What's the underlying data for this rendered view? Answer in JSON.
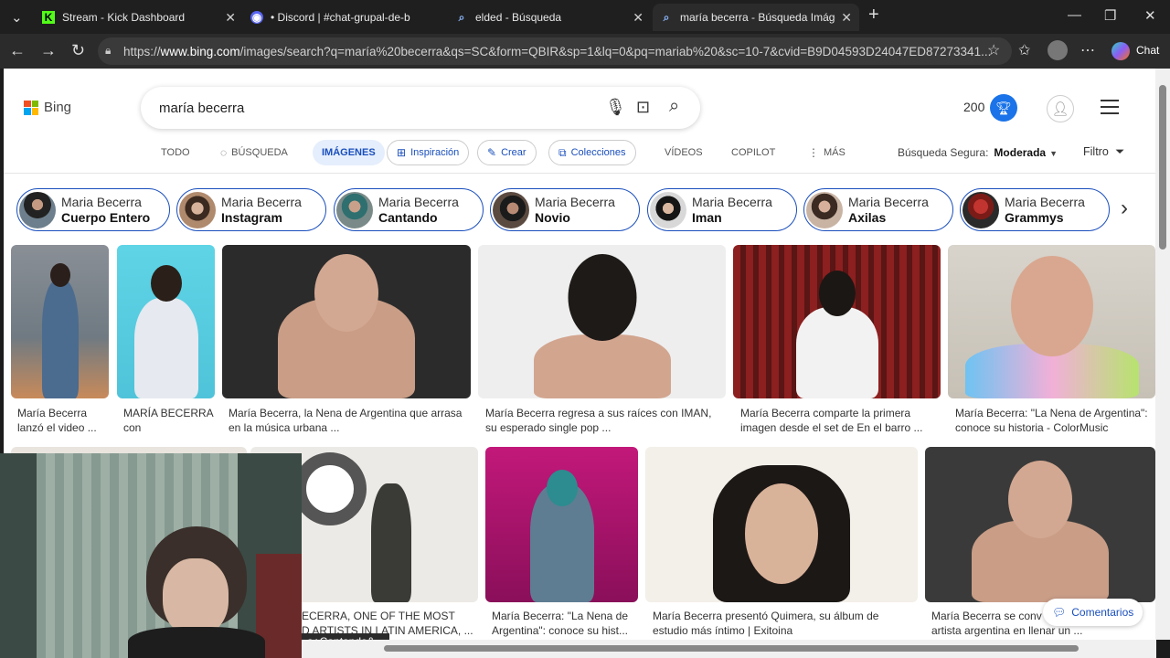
{
  "tabs": [
    {
      "label": "Stream - Kick Dashboard",
      "icon": "kick-icon"
    },
    {
      "label": "• Discord | #chat-grupal-de-b",
      "icon": "discord-icon"
    },
    {
      "label": "elded - Búsqueda",
      "icon": "search-icon"
    },
    {
      "label": "maría becerra - Búsqueda Imágen",
      "icon": "search-icon"
    }
  ],
  "browser": {
    "url_domain": "www.bing.com",
    "url_prefix": "https://",
    "url_rest": "/images/search?q=maría%20becerra&qs=SC&form=QBIR&sp=1&lq=0&pq=mariab%20&sc=10-7&cvid=B9D04593D24047ED87273341...",
    "chat_label": "Chat"
  },
  "bing": {
    "logo_text": "Bing",
    "search_value": "maría becerra",
    "rewards_points": "200"
  },
  "nav": {
    "todo": "TODO",
    "busqueda": "BÚSQUEDA",
    "imagenes": "IMÁGENES",
    "inspiracion": "Inspiración",
    "crear": "Crear",
    "colecciones": "Colecciones",
    "videos": "VÍDEOS",
    "copilot": "COPILOT",
    "mas": "MÁS",
    "safe_label": "Búsqueda Segura:",
    "safe_value": "Moderada",
    "filter_label": "Filtro"
  },
  "chips": [
    {
      "line1": "Maria Becerra",
      "line2": "Cuerpo Entero"
    },
    {
      "line1": "Maria Becerra",
      "line2": "Instagram"
    },
    {
      "line1": "Maria Becerra",
      "line2": "Cantando"
    },
    {
      "line1": "Maria Becerra",
      "line2": "Novio"
    },
    {
      "line1": "Maria Becerra",
      "line2": "Iman"
    },
    {
      "line1": "Maria Becerra",
      "line2": "Axilas"
    },
    {
      "line1": "Maria Becerra",
      "line2": "Grammys"
    }
  ],
  "results_row1": [
    {
      "caption": "María Becerra lanzó el video ..."
    },
    {
      "caption": "MARÍA BECERRA con"
    },
    {
      "caption": "María Becerra, la Nena de Argentina que arrasa en la música urbana ..."
    },
    {
      "caption": "María Becerra regresa a sus raíces con IMAN, su esperado single pop ..."
    },
    {
      "caption": "María Becerra comparte la primera imagen desde el set de En el barro ..."
    },
    {
      "caption": "María Becerra: \"La Nena de Argentina\": conoce su historia - ColorMusic"
    }
  ],
  "results_row2": [
    {
      "caption": "ECERRA, ONE OF THE MOST\nD ARTISTS IN LATIN AMERICA, ..."
    },
    {
      "caption": "María Becerra: \"La Nena de Argentina\": conoce su hist..."
    },
    {
      "caption": "María Becerra presentó Quimera, su álbum de estudio más íntimo | Exitoina"
    },
    {
      "caption": "María Becerra se conv\nartista argentina en llenar un ..."
    }
  ],
  "tooltip": "a+Cantando&...",
  "feedback_label": "Comentarios"
}
